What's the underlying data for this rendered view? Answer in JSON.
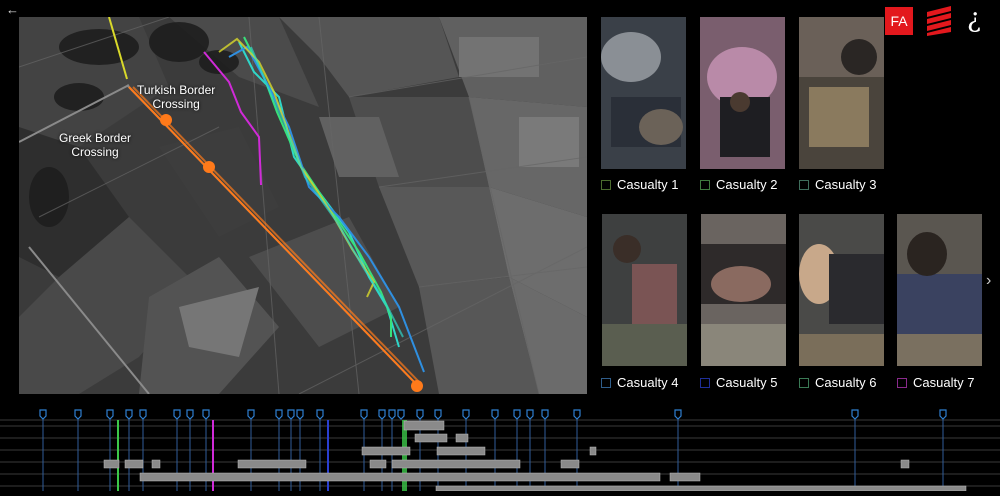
{
  "app": {
    "back_icon": "back-arrow-icon",
    "back_symbol": "←",
    "next_icon": "chevron-right-icon",
    "next_symbol": "›"
  },
  "logos": {
    "fa_label": "FA",
    "fa_color": "#e3181d",
    "info_symbol": "¿"
  },
  "map": {
    "labels": {
      "turkish": "Turkish Border\nCrossing",
      "greek": "Greek Border\nCrossing"
    },
    "colors": {
      "orange": "#ff7a1a",
      "cyan": "#2fd6c9",
      "blue": "#2f8fe0",
      "green": "#39e07a",
      "magenta": "#d02ad8",
      "yellow": "#d9d92a"
    }
  },
  "casualties": [
    {
      "label": "Casualty 1",
      "color": "#4b6b2e"
    },
    {
      "label": "Casualty 2",
      "color": "#3f7a3f"
    },
    {
      "label": "Casualty 3",
      "color": "#3f6e5c"
    },
    {
      "label": "Casualty 4",
      "color": "#2f5d8a"
    },
    {
      "label": "Casualty 5",
      "color": "#1f2f9a"
    },
    {
      "label": "Casualty 6",
      "color": "#3a7a55"
    },
    {
      "label": "Casualty 7",
      "color": "#8a2a8c"
    }
  ],
  "timeline": {
    "accent_colors": {
      "marker": "#2f7fd0",
      "green": "#3cc84a",
      "magenta": "#d02ad8",
      "blue": "#2a3fd0"
    }
  }
}
